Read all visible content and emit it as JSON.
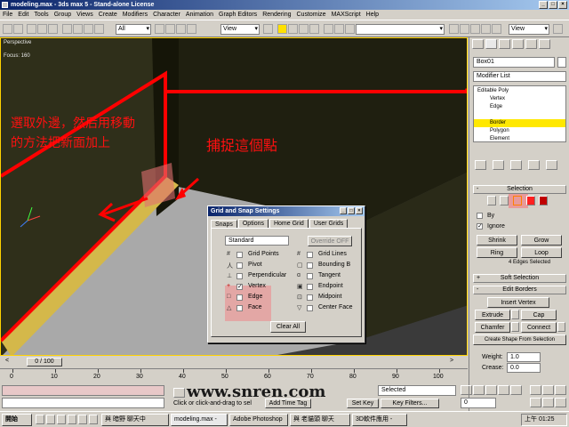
{
  "window": {
    "title": "modeling.max - 3ds max 5 - Stand-alone License"
  },
  "menu": [
    "File",
    "Edit",
    "Tools",
    "Group",
    "Views",
    "Create",
    "Modifiers",
    "Character",
    "Animation",
    "Graph Editors",
    "Rendering",
    "Customize",
    "MAXScript",
    "Help"
  ],
  "toolbar": {
    "selection_filter": "All",
    "coord_system": "View",
    "coord_system_right": "View"
  },
  "viewport": {
    "label": "Perspective",
    "label2": "Focus: 160",
    "annotation_left_line1": "選取外邊，然后用移動",
    "annotation_left_line2": "的方法把新面加上",
    "annotation_center": "捕捉這個點",
    "colors": {
      "wall": "#1a1a0a",
      "floor": "#a8a8a8",
      "selection": "#ff0000",
      "edge": "#d4b84a"
    }
  },
  "dialog": {
    "title": "Grid and Snap Settings",
    "tabs": [
      "Snaps",
      "Options",
      "Home Grid",
      "User Grids"
    ],
    "dropdown": "Standard",
    "override_button": "Override OFF",
    "left_items": [
      {
        "label": "Grid Points",
        "checked": false
      },
      {
        "label": "Pivot",
        "checked": false
      },
      {
        "label": "Perpendicular",
        "checked": false
      },
      {
        "label": "Vertex",
        "checked": true
      },
      {
        "label": "Edge",
        "checked": false
      },
      {
        "label": "Face",
        "checked": false
      }
    ],
    "right_items": [
      {
        "label": "Grid Lines",
        "checked": false
      },
      {
        "label": "Bounding B",
        "checked": false
      },
      {
        "label": "Tangent",
        "checked": false
      },
      {
        "label": "Endpoint",
        "checked": false
      },
      {
        "label": "Midpoint",
        "checked": false
      },
      {
        "label": "Center Face",
        "checked": false
      }
    ],
    "clear_all": "Clear All"
  },
  "panel": {
    "object_name": "Box01",
    "modifier_list": "Modifier List",
    "stack": [
      "Editable Poly",
      "Vertex",
      "Edge",
      "Border",
      "Polygon",
      "Element"
    ],
    "selected_stack": "Border",
    "selection_rollout": "Selection",
    "by_label": "By",
    "ignore_label": "Ignore",
    "shrink": "Shrink",
    "grow": "Grow",
    "ring": "Ring",
    "loop": "Loop",
    "selection_status": "4 Edges Selected",
    "soft_selection": "Soft Selection",
    "edit_borders": "Edit Borders",
    "insert_vertex": "Insert Vertex",
    "extrude": "Extrude",
    "cap": "Cap",
    "chamfer": "Chamfer",
    "connect": "Connect",
    "create_shape": "Create Shape From Selection",
    "weight_label": "Weight:",
    "weight_value": "1.0",
    "crease_label": "Crease:",
    "crease_value": "0.0"
  },
  "timeline": {
    "frame_display": "0 / 100",
    "ticks": [
      "0",
      "10",
      "20",
      "30",
      "40",
      "50",
      "60",
      "70",
      "80",
      "90",
      "100"
    ]
  },
  "status": {
    "prompt": "Click or click-and-drag to sel",
    "add_time_tag": "Add Time Tag",
    "set_key": "Set Key",
    "key_filters": "Key Filters...",
    "selected": "Selected",
    "frame": "0",
    "watermark": "www.snren.com"
  },
  "taskbar": {
    "start": "開始",
    "tasks": [
      "與 暗野 聊天中",
      "modeling.max -",
      "Adobe Photoshop",
      "與 老貓頭 聊天",
      "3D軟件應用 -"
    ],
    "clock": "上午 01:25"
  }
}
